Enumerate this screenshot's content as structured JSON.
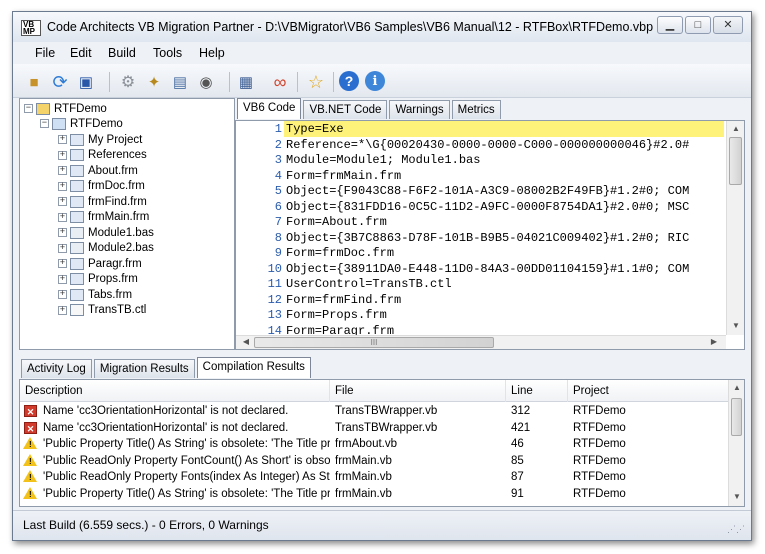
{
  "window": {
    "title": "Code Architects VB Migration Partner - D:\\VBMigrator\\VB6 Samples\\VB6 Manual\\12 - RTFBox\\RTFDemo.vbp",
    "app_icon_text": "VB MP",
    "controls": {
      "minimize": "▁",
      "maximize": "□",
      "close": "✕"
    }
  },
  "menu": [
    "File",
    "Edit",
    "Build",
    "Tools",
    "Help"
  ],
  "toolbar": {
    "buttons": [
      {
        "icon": "open-folder-icon",
        "glyph": "📂"
      },
      {
        "icon": "refresh-icon",
        "glyph": "⟳"
      },
      {
        "icon": "save-icon",
        "glyph": "💾"
      },
      {
        "icon": "settings-gear-icon",
        "glyph": "⚙"
      },
      {
        "icon": "magic-wand-icon",
        "glyph": "✨"
      },
      {
        "icon": "compile-icon",
        "glyph": "🗂"
      },
      {
        "icon": "view-icon",
        "glyph": "👓"
      },
      {
        "icon": "grid-icon",
        "glyph": "▦"
      },
      {
        "icon": "link-icon",
        "glyph": "∞"
      },
      {
        "icon": "favorite-star-icon",
        "glyph": "☆"
      },
      {
        "icon": "help-icon",
        "glyph": "?"
      },
      {
        "icon": "info-icon",
        "glyph": "i"
      }
    ]
  },
  "tree": {
    "root": "RTFDemo",
    "project": "RTFDemo",
    "items": [
      "My Project",
      "References",
      "About.frm",
      "frmDoc.frm",
      "frmFind.frm",
      "frmMain.frm",
      "Module1.bas",
      "Module2.bas",
      "Paragr.frm",
      "Props.frm",
      "Tabs.frm",
      "TransTB.ctl"
    ]
  },
  "code_tabs": [
    "VB6 Code",
    "VB.NET Code",
    "Warnings",
    "Metrics"
  ],
  "code_tabs_active": "VB6 Code",
  "code": {
    "line_numbers": [
      "1",
      "2",
      "3",
      "4",
      "5",
      "6",
      "7",
      "8",
      "9",
      "10",
      "11",
      "12",
      "13",
      "14"
    ],
    "lines": [
      "Type=Exe",
      "Reference=*\\G{00020430-0000-0000-C000-000000000046}#2.0#",
      "Module=Module1; Module1.bas",
      "Form=frmMain.frm",
      "Object={F9043C88-F6F2-101A-A3C9-08002B2F49FB}#1.2#0; COM",
      "Object={831FDD16-0C5C-11D2-A9FC-0000F8754DA1}#2.0#0; MSC",
      "Form=About.frm",
      "Object={3B7C8863-D78F-101B-B9B5-04021C009402}#1.2#0; RIC",
      "Form=frmDoc.frm",
      "Object={38911DA0-E448-11D0-84A3-00DD01104159}#1.1#0; COM",
      "UserControl=TransTB.ctl",
      "Form=frmFind.frm",
      "Form=Props.frm",
      "Form=Paragr.frm"
    ],
    "hscroll_grip": "III"
  },
  "bottom_tabs": [
    "Activity Log",
    "Migration Results",
    "Compilation Results"
  ],
  "bottom_tabs_active": "Compilation Results",
  "results": {
    "columns": [
      "Description",
      "File",
      "Line",
      "Project"
    ],
    "rows": [
      {
        "type": "error",
        "description": "Name 'cc3OrientationHorizontal' is not declared.",
        "file": "TransTBWrapper.vb",
        "line": "312",
        "project": "RTFDemo"
      },
      {
        "type": "error",
        "description": "Name 'cc3OrientationHorizontal' is not declared.",
        "file": "TransTBWrapper.vb",
        "line": "421",
        "project": "RTFDemo"
      },
      {
        "type": "warning",
        "description": "'Public Property Title() As String' is obsolete: 'The Title proper...",
        "file": "frmAbout.vb",
        "line": "46",
        "project": "RTFDemo"
      },
      {
        "type": "warning",
        "description": "'Public ReadOnly Property FontCount() As Short' is obsolete: '...",
        "file": "frmMain.vb",
        "line": "85",
        "project": "RTFDemo"
      },
      {
        "type": "warning",
        "description": "'Public ReadOnly Property Fonts(index As Integer) As String' i...",
        "file": "frmMain.vb",
        "line": "87",
        "project": "RTFDemo"
      },
      {
        "type": "warning",
        "description": "'Public Property Title() As String' is obsolete: 'The Title proper...",
        "file": "frmMain.vb",
        "line": "91",
        "project": "RTFDemo"
      }
    ]
  },
  "status": "Last Build (6.559 secs.) - 0 Errors, 0 Warnings"
}
